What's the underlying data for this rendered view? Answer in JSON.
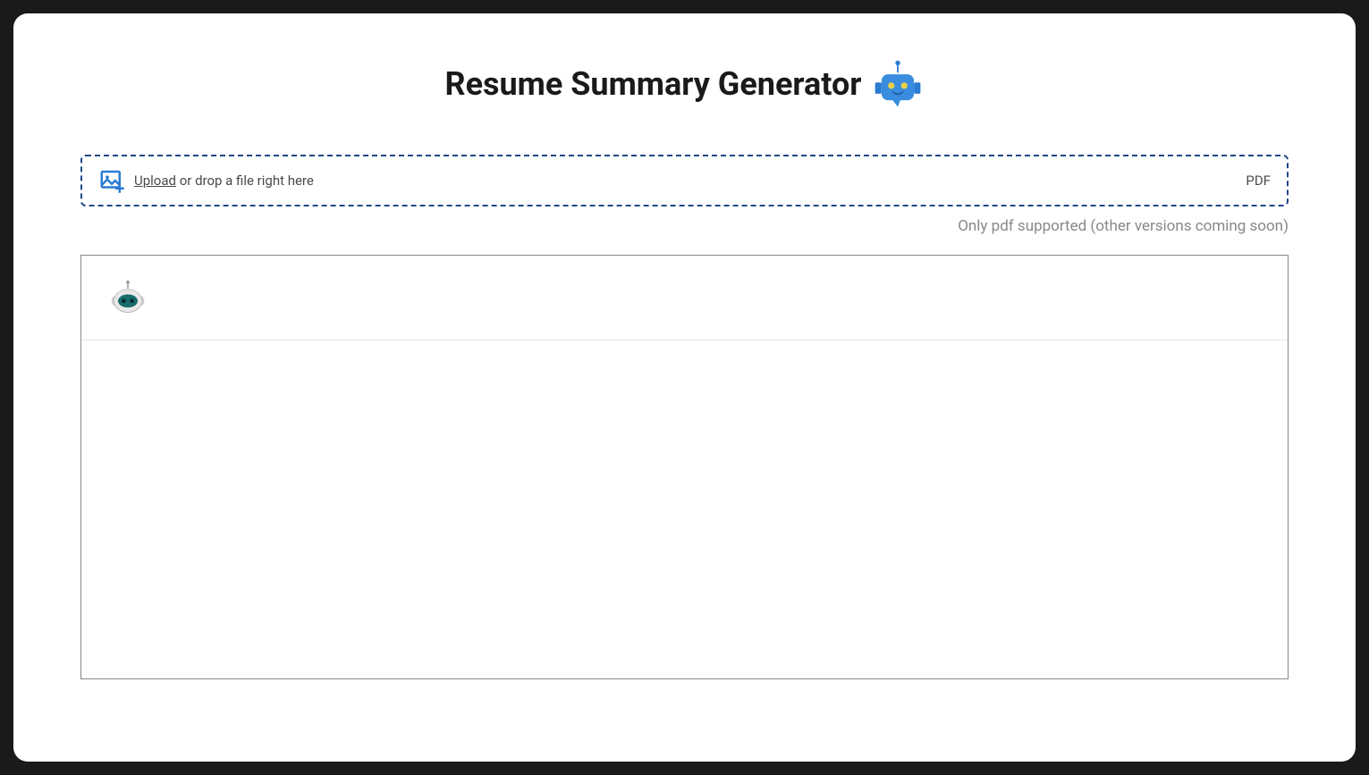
{
  "header": {
    "title": "Resume Summary Generator"
  },
  "upload": {
    "link_text": "Upload",
    "drop_text": " or drop a file right here",
    "file_type": "PDF"
  },
  "support_message": "Only pdf supported (other versions coming soon)",
  "chat": {
    "messages": []
  }
}
